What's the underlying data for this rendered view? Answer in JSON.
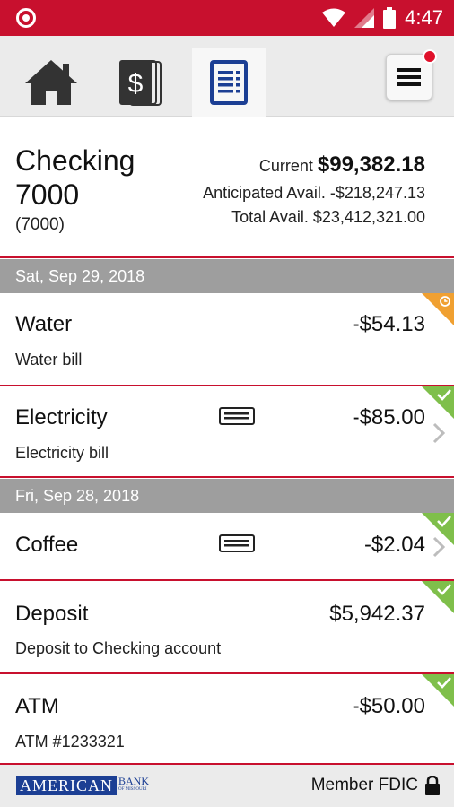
{
  "status_bar": {
    "time": "4:47"
  },
  "nav": {
    "tabs": [
      {
        "name": "home",
        "icon": "home-icon"
      },
      {
        "name": "deposit",
        "icon": "dollar-check-icon"
      },
      {
        "name": "register",
        "icon": "register-icon",
        "active": true
      }
    ],
    "menu_icon": "hamburger-icon",
    "notification": true
  },
  "account": {
    "name": "Checking 7000",
    "number": "(7000)",
    "current_label": "Current",
    "current_value": "$99,382.18",
    "anticipated_text": "Anticipated Avail. -$218,247.13",
    "total_text": "Total Avail. $23,412,321.00"
  },
  "groups": [
    {
      "date": "Sat, Sep 29, 2018",
      "transactions": [
        {
          "name": "Water",
          "description": "Water bill",
          "amount": "-$54.13",
          "status": "pending"
        },
        {
          "name": "Electricity",
          "description": "Electricity bill",
          "amount": "-$85.00",
          "status": "cleared",
          "has_receipt": true,
          "has_chevron": true
        }
      ]
    },
    {
      "date": "Fri, Sep 28, 2018",
      "transactions": [
        {
          "name": "Coffee",
          "amount": "-$2.04",
          "status": "cleared",
          "has_receipt": true,
          "has_chevron": true
        },
        {
          "name": "Deposit",
          "description": "Deposit to Checking account",
          "amount": "$5,942.37",
          "status": "cleared"
        },
        {
          "name": "ATM",
          "description": "ATM #1233321",
          "amount": "-$50.00",
          "status": "cleared"
        }
      ]
    }
  ],
  "footer": {
    "logo_text": "AMERICAN",
    "logo_bank": "BANK",
    "logo_sub": "OF MISSOURI",
    "fdic_text": "Member FDIC"
  },
  "colors": {
    "brand_red": "#c8102e",
    "brand_blue": "#1c3f94",
    "cleared": "#7fbf4b",
    "pending": "#f0a031"
  }
}
